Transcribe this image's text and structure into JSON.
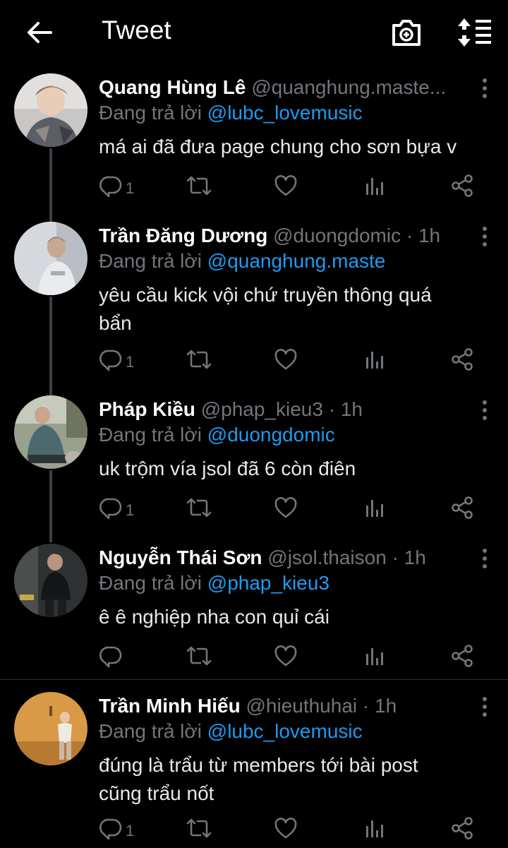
{
  "topbar": {
    "title": "Tweet"
  },
  "tweets": [
    {
      "name": "Quang Hùng Lê",
      "handle": "@quanghung.maste...",
      "time": "",
      "reply_prefix": "Đang trả lời",
      "reply_to": "@lubc_lovemusic",
      "text": "má ai đã đưa page chung cho sơn bựa v",
      "reply_count": "1"
    },
    {
      "name": "Trần Đăng Dương",
      "handle": "@duongdomic",
      "time": "· 1h",
      "reply_prefix": "Đang trả lời",
      "reply_to": "@quanghung.maste",
      "text": "yêu cầu kick vội chứ truyền thông quá bẩn",
      "reply_count": "1"
    },
    {
      "name": "Pháp Kiều",
      "handle": "@phap_kieu3",
      "time": "· 1h",
      "reply_prefix": "Đang trả lời",
      "reply_to": "@duongdomic",
      "text": "uk trộm vía jsol đã 6 còn điên",
      "reply_count": "1"
    },
    {
      "name": "Nguyễn Thái Sơn",
      "handle": "@jsol.thaison",
      "time": "· 1h",
      "reply_prefix": "Đang trả lời",
      "reply_to": "@phap_kieu3",
      "text": "ê ê nghiệp nha con quỉ cái",
      "reply_count": ""
    },
    {
      "name": "Trần Minh Hiếu",
      "handle": "@hieuthuhai",
      "time": "· 1h",
      "reply_prefix": "Đang trả lời",
      "reply_to": "@lubc_lovemusic",
      "text": "đúng là trẩu từ members tới bài post cũng trẩu nốt",
      "reply_count": "1"
    }
  ],
  "colors": {
    "background": "#000000",
    "accent": "#1d9bf0",
    "muted": "#71767b",
    "text": "#e7e9ea"
  },
  "icons": [
    "back-arrow-icon",
    "camera-icon",
    "sort-icon",
    "more-vertical-icon",
    "reply-icon",
    "retweet-icon",
    "like-icon",
    "analytics-icon",
    "share-icon"
  ]
}
